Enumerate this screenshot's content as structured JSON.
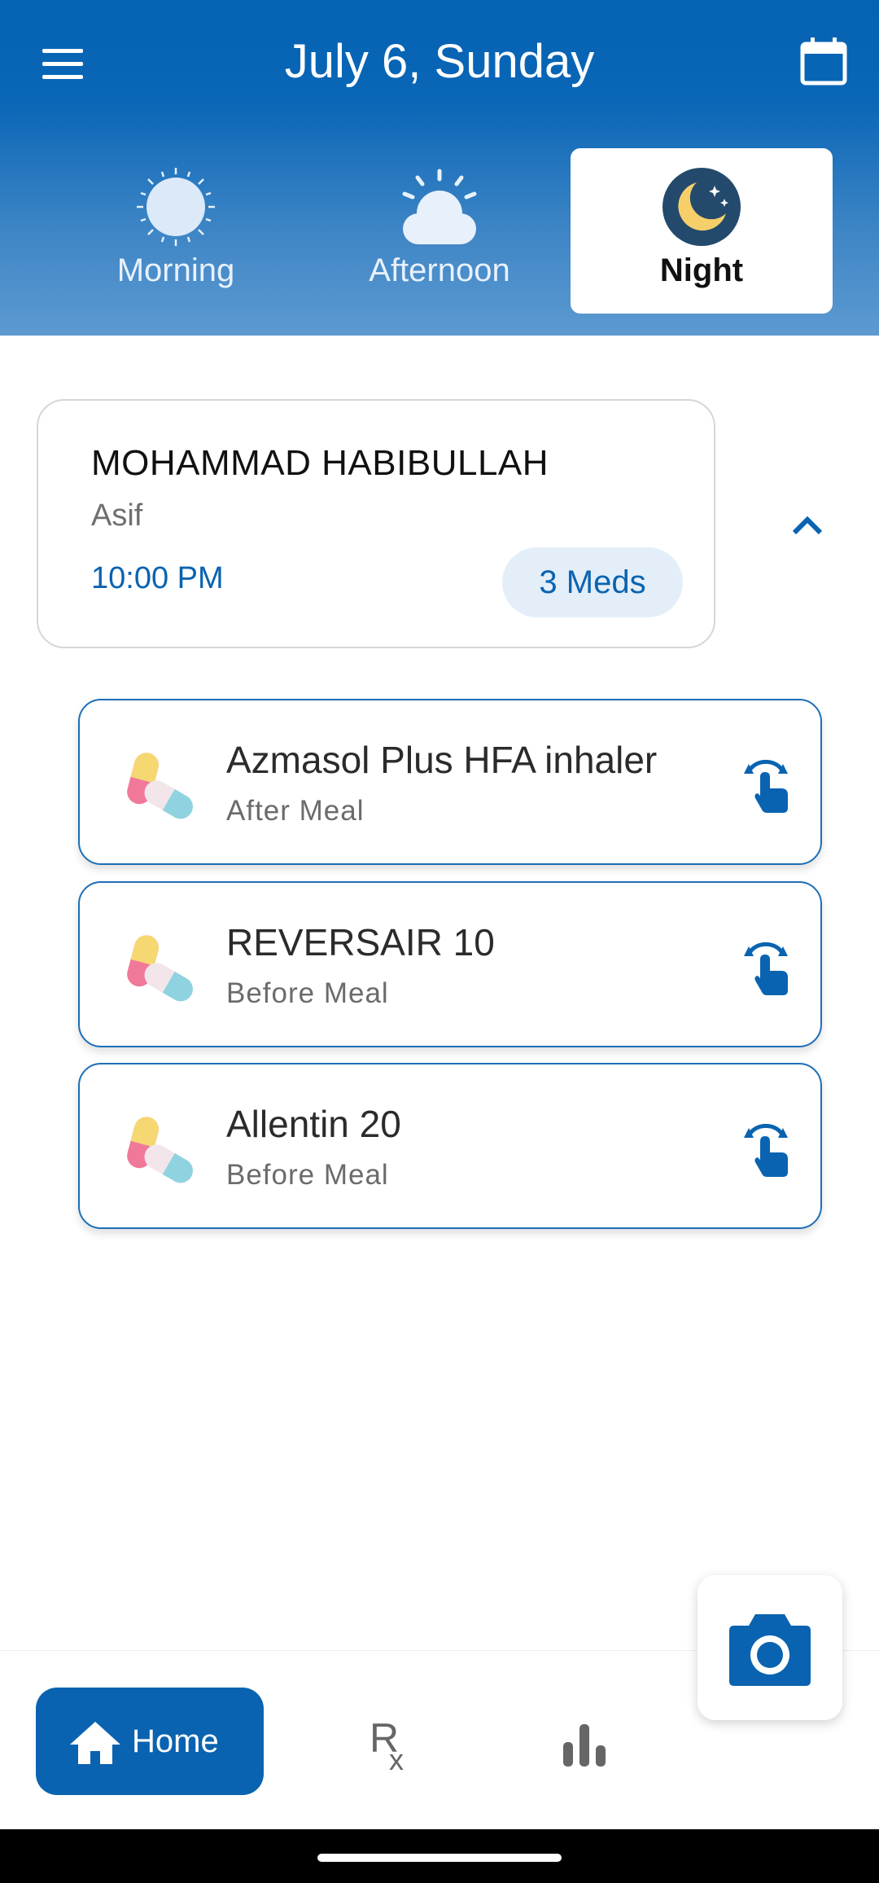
{
  "header": {
    "title": "July 6, Sunday",
    "tabs": [
      {
        "label": "Morning"
      },
      {
        "label": "Afternoon"
      },
      {
        "label": "Night"
      }
    ]
  },
  "patient": {
    "name": "MOHAMMAD HABIBULLAH",
    "subtitle": "Asif",
    "time": "10:00 PM",
    "meds_badge": "3 Meds"
  },
  "medications": [
    {
      "name": "Azmasol Plus HFA inhaler",
      "instruction": "After Meal"
    },
    {
      "name": "REVERSAIR 10",
      "instruction": "Before Meal"
    },
    {
      "name": "Allentin 20",
      "instruction": "Before Meal"
    }
  ],
  "bottom_nav": {
    "home_label": "Home",
    "rx_label": "Rx"
  },
  "colors": {
    "primary": "#0a63b0",
    "header_gradient_top": "#0563b4",
    "header_gradient_bottom": "#5d9ad1",
    "badge_bg": "#e3eef8"
  },
  "icons": [
    "menu-icon",
    "calendar-icon",
    "sun-icon",
    "cloud-sun-icon",
    "moon-icon",
    "chevron-up-icon",
    "pill-icon",
    "tap-gesture-icon",
    "camera-icon",
    "home-icon",
    "rx-icon",
    "bar-chart-icon"
  ]
}
